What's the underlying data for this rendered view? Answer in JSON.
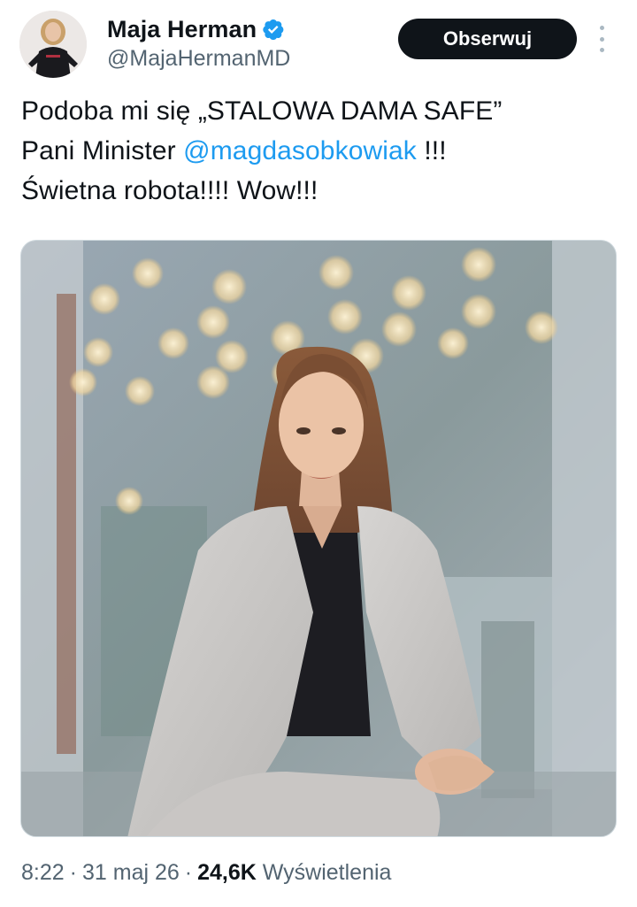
{
  "author": {
    "display_name": "Maja Herman",
    "handle": "@MajaHermanMD",
    "verified_icon": "verified-badge-icon",
    "verified_color": "#1d9bf0"
  },
  "follow_button": {
    "label": "Obserwuj"
  },
  "more_menu": {
    "icon": "more-vertical-icon"
  },
  "tweet": {
    "line1": "Podoba mi się „STALOWA DAMA SAFE”",
    "line2_prefix": "Pani Minister ",
    "mention": "@magdasobkowiak",
    "line2_suffix": " !!!",
    "line3": "Świetna robota!!!! Wow!!!"
  },
  "meta": {
    "time": "8:22",
    "date": "31 maj 26",
    "views_count": "24,6K",
    "views_label": "Wyświetlenia"
  },
  "colors": {
    "text": "#0f1419",
    "secondary": "#536471",
    "accent": "#1d9bf0",
    "button_bg": "#0f1419"
  }
}
